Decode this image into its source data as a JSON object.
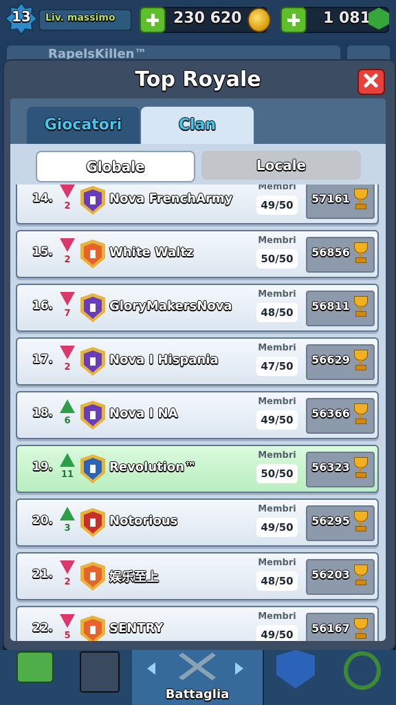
{
  "hud": {
    "level": "13",
    "level_label": "Liv. massimo",
    "gold": "230 620",
    "gems": "1 081"
  },
  "background": {
    "profile_name": "RapelsKillen™"
  },
  "modal": {
    "title": "Top Royale",
    "tabs": [
      {
        "label": "Giocatori",
        "active": false
      },
      {
        "label": "Clan",
        "active": true
      }
    ],
    "scope": [
      {
        "label": "Globale",
        "active": true
      },
      {
        "label": "Locale",
        "active": false
      }
    ],
    "members_label": "Membri",
    "clans": [
      {
        "rank": "14.",
        "trend": "down",
        "change": "2",
        "name": "Nova FrenchArmy",
        "members": "49/50",
        "trophies": "57161",
        "badge": "purple"
      },
      {
        "rank": "15.",
        "trend": "down",
        "change": "2",
        "name": "White Waltz",
        "members": "50/50",
        "trophies": "56856",
        "badge": "orange"
      },
      {
        "rank": "16.",
        "trend": "down",
        "change": "7",
        "name": "GloryMakersNova",
        "members": "48/50",
        "trophies": "56811",
        "badge": "purple"
      },
      {
        "rank": "17.",
        "trend": "down",
        "change": "2",
        "name": "Nova I Hispania",
        "members": "47/50",
        "trophies": "56629",
        "badge": "purple"
      },
      {
        "rank": "18.",
        "trend": "up",
        "change": "6",
        "name": "Nova I NA",
        "members": "49/50",
        "trophies": "56366",
        "badge": "purple"
      },
      {
        "rank": "19.",
        "trend": "up",
        "change": "11",
        "name": "Revolution™",
        "members": "50/50",
        "trophies": "56323",
        "badge": "blue",
        "highlight": true
      },
      {
        "rank": "20.",
        "trend": "up",
        "change": "3",
        "name": "Notorious",
        "members": "49/50",
        "trophies": "56295",
        "badge": "red"
      },
      {
        "rank": "21.",
        "trend": "down",
        "change": "2",
        "name": "娱乐至上",
        "members": "48/50",
        "trophies": "56203",
        "badge": "orange"
      },
      {
        "rank": "22.",
        "trend": "down",
        "change": "5",
        "name": "SENTRY",
        "members": "49/50",
        "trophies": "56167",
        "badge": "orange"
      }
    ]
  },
  "bottom_nav": {
    "battle_label": "Battaglia"
  },
  "colors": {
    "badge_purple": "#6a3db8",
    "badge_orange": "#e8632a",
    "badge_blue": "#2a63b8",
    "badge_red": "#c9302c"
  }
}
